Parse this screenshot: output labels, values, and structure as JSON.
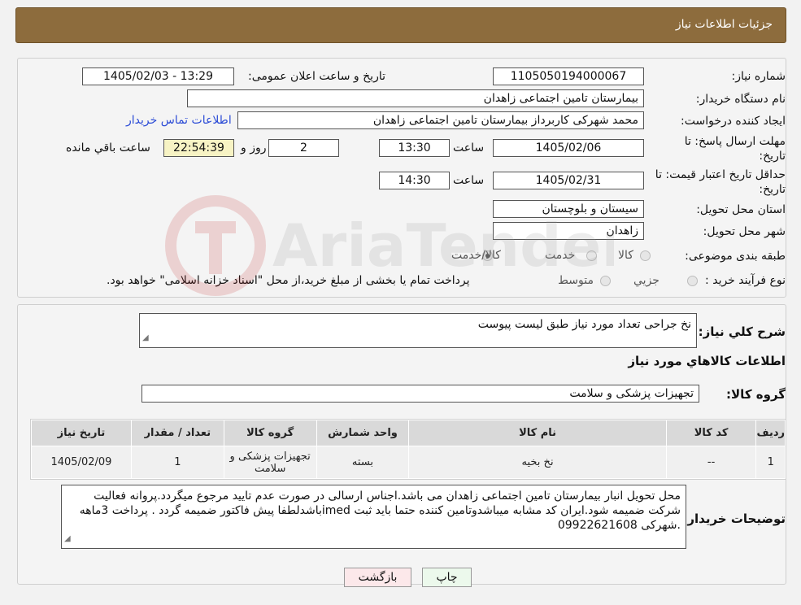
{
  "header": {
    "title": "جزئیات اطلاعات نیاز"
  },
  "form": {
    "need_number_label": "شماره نیاز:",
    "need_number": "1105050194000067",
    "announce_label": "تاریخ و ساعت اعلان عمومی:",
    "announce_value": "1405/02/03 - 13:29",
    "buyer_org_label": "نام دستگاه خریدار:",
    "buyer_org": "بیمارستان تامین اجتماعی زاهدان",
    "creator_label": "ایجاد کننده درخواست:",
    "creator": "محمد شهرکی کاربرداز بیمارستان تامین اجتماعی زاهدان",
    "contact_link": "اطلاعات تماس خریدار",
    "deadline_label_1": "مهلت ارسال پاسخ: تا",
    "deadline_label_2": "تاریخ:",
    "deadline_date": "1405/02/06",
    "hour_label": "ساعت",
    "deadline_time": "13:30",
    "days_value": "2",
    "days_label": "روز و",
    "remaining_time": "22:54:39",
    "remaining_label": "ساعت باقي مانده",
    "validity_label_1": "حداقل تاریخ اعتبار قیمت: تا",
    "validity_label_2": "تاریخ:",
    "validity_date": "1405/02/31",
    "validity_hour_label": "ساعت",
    "validity_time": "14:30",
    "province_label": "استان محل تحویل:",
    "province": "سیستان و بلوچستان",
    "city_label": "شهر محل تحویل:",
    "city": "زاهدان",
    "category_label": "طبقه بندی موضوعی:",
    "category_options": [
      "کالا",
      "خدمت",
      "کالا/خدمت"
    ],
    "process_label": "نوع فرآیند خرید :",
    "process_options": [
      "جزیي",
      "متوسط"
    ],
    "process_note": "پرداخت تمام یا بخشی از مبلغ خرید،از محل \"اسناد خزانه اسلامی\" خواهد بود."
  },
  "watermark": {
    "text": "AriaTender.neT"
  },
  "details": {
    "summary_label": "شرح کلي نیاز:",
    "summary": "نخ جراحی تعداد مورد نیاز طبق لیست پیوست",
    "goods_info_title": "اطلاعات کالاهاي مورد نیاز",
    "goods_group_label": "گروه کالا:",
    "goods_group": "تجهیزات پزشکی و سلامت",
    "table": {
      "headers": [
        "ردیف",
        "کد کالا",
        "نام کالا",
        "واحد شمارش",
        "گروه کالا",
        "تعداد / مقدار",
        "تاریخ نیاز"
      ],
      "rows": [
        [
          "1",
          "--",
          "نخ بخیه",
          "بسته",
          "تجهیزات پزشکی و سلامت",
          "1",
          "1405/02/09"
        ]
      ]
    },
    "buyer_notes_label": "توضیحات خریدار:",
    "buyer_notes": "محل تحویل انبار بیمارستان تامین اجتماعی زاهدان می باشد.اجناس ارسالی در صورت عدم تایید مرجوع میگردد.پروانه فعالیت شرکت ضمیمه شود.ایران کد مشابه میباشدوتامین کننده حتما باید ثبت imedباشدلطفا پیش فاکتور ضمیمه گردد . پرداخت 3ماهه  .شهرکی 09922621608"
  },
  "buttons": {
    "print": "چاپ",
    "back": "بازگشت"
  }
}
